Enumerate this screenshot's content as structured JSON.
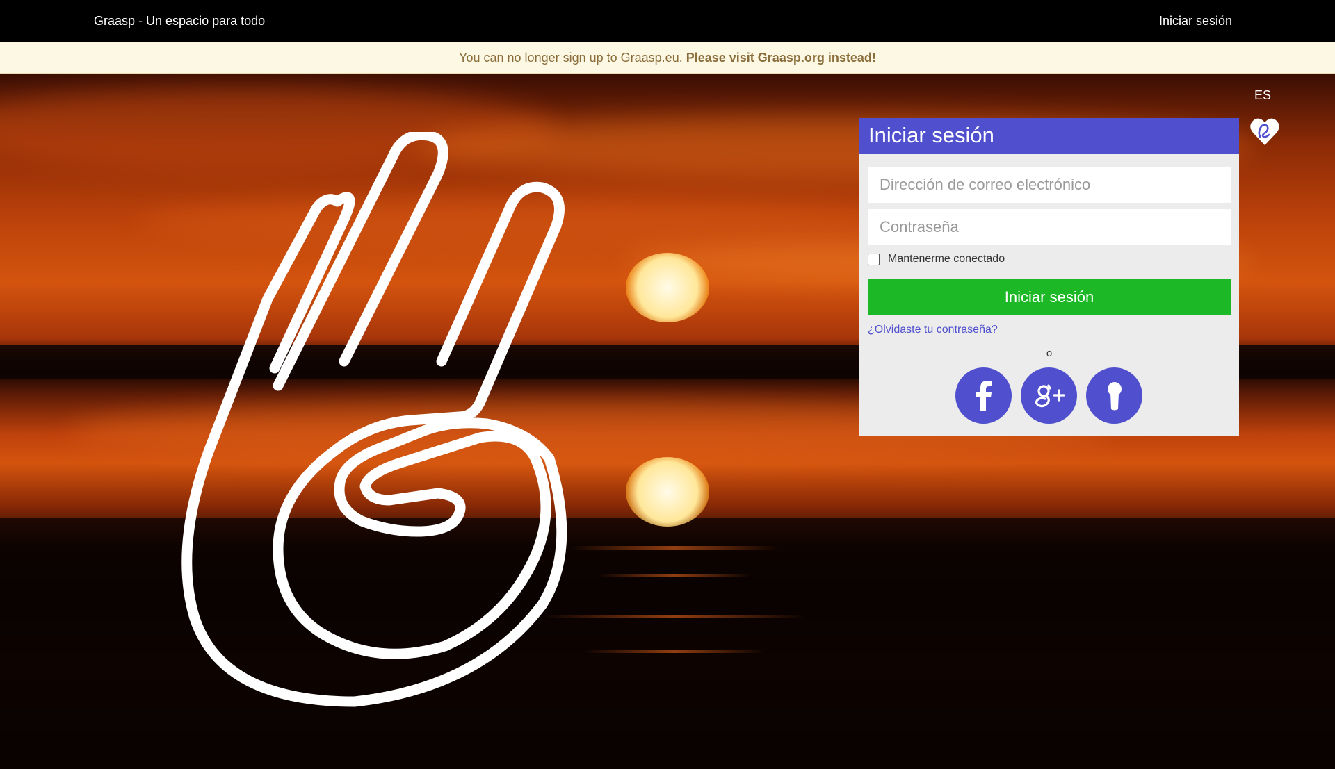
{
  "topbar": {
    "brand": "Graasp - Un espacio para todo",
    "login_link": "Iniciar sesión"
  },
  "notice": {
    "text": "You can no longer sign up to Graasp.eu.",
    "emphasis": "Please visit Graasp.org instead!"
  },
  "language": "ES",
  "login_panel": {
    "title": "Iniciar sesión",
    "email_placeholder": "Dirección de correo electrónico",
    "password_placeholder": "Contraseña",
    "remember_label": "Mantenerme conectado",
    "submit_label": "Iniciar sesión",
    "forgot_link": "¿Olvidaste tu contraseña?",
    "or_label": "o",
    "social": [
      {
        "icon": "facebook-icon"
      },
      {
        "icon": "google-plus-icon"
      },
      {
        "icon": "keyhole-icon"
      }
    ]
  },
  "colors": {
    "accent": "#5050cf",
    "submit": "#1cb825",
    "notice_bg": "#fcf8e3",
    "notice_text": "#8a6d3b",
    "topbar": "#000000"
  }
}
